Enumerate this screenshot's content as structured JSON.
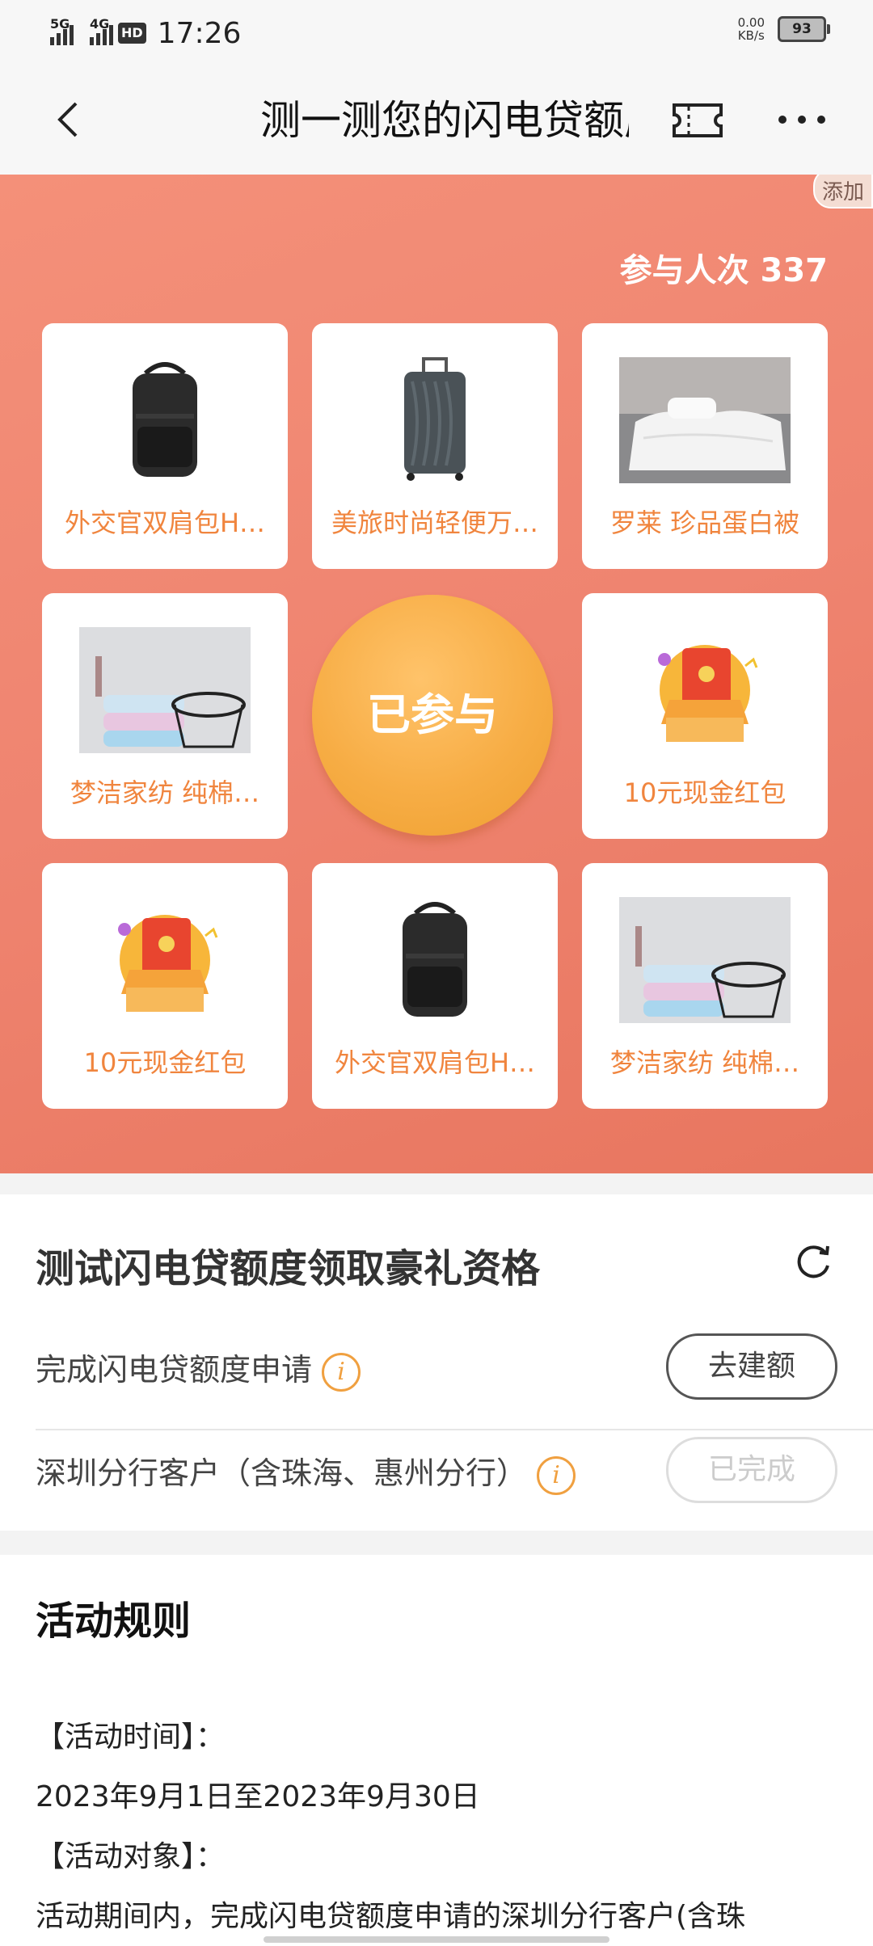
{
  "status_bar": {
    "network1": "5G",
    "network2": "4G",
    "hd": "HD",
    "time": "17:26",
    "speed_value": "0.00",
    "speed_unit": "KB/s",
    "battery": "93"
  },
  "nav": {
    "title": "测一测您的闪电贷额度",
    "back_icon": "chevron-left-icon",
    "ticket_icon": "ticket-icon",
    "more_icon": "more-dots-icon"
  },
  "hero": {
    "add_tag": "添加",
    "participants": "参与人次 337",
    "center_button": "已参与",
    "prizes": [
      {
        "label": "外交官双肩包H…",
        "icon": "backpack"
      },
      {
        "label": "美旅时尚轻便万…",
        "icon": "suitcase"
      },
      {
        "label": "罗莱 珍品蛋白被",
        "icon": "quilt"
      },
      {
        "label": "梦洁家纺 纯棉…",
        "icon": "towels"
      },
      {
        "label": "10元现金红包",
        "icon": "red-packet"
      },
      {
        "label": "10元现金红包",
        "icon": "red-packet"
      },
      {
        "label": "外交官双肩包H…",
        "icon": "backpack"
      },
      {
        "label": "梦洁家纺 纯棉…",
        "icon": "towels"
      }
    ]
  },
  "requirements": {
    "title": "测试闪电贷额度领取豪礼资格",
    "rows": [
      {
        "text": "完成闪电贷额度申请",
        "button": "去建额",
        "state": "active"
      },
      {
        "text": "深圳分行客户（含珠海、惠州分行）",
        "button": "已完成",
        "state": "done"
      }
    ]
  },
  "rules": {
    "title": "活动规则",
    "lines": [
      "【活动时间】：",
      "2023年9月1日至2023年9月30日",
      "【活动对象】：",
      "活动期间内，完成闪电贷额度申请的深圳分行客户(含珠"
    ]
  },
  "colors": {
    "hero_bg": "#ef8470",
    "prize_label": "#f0853e",
    "center_button": "#f7ad45"
  }
}
